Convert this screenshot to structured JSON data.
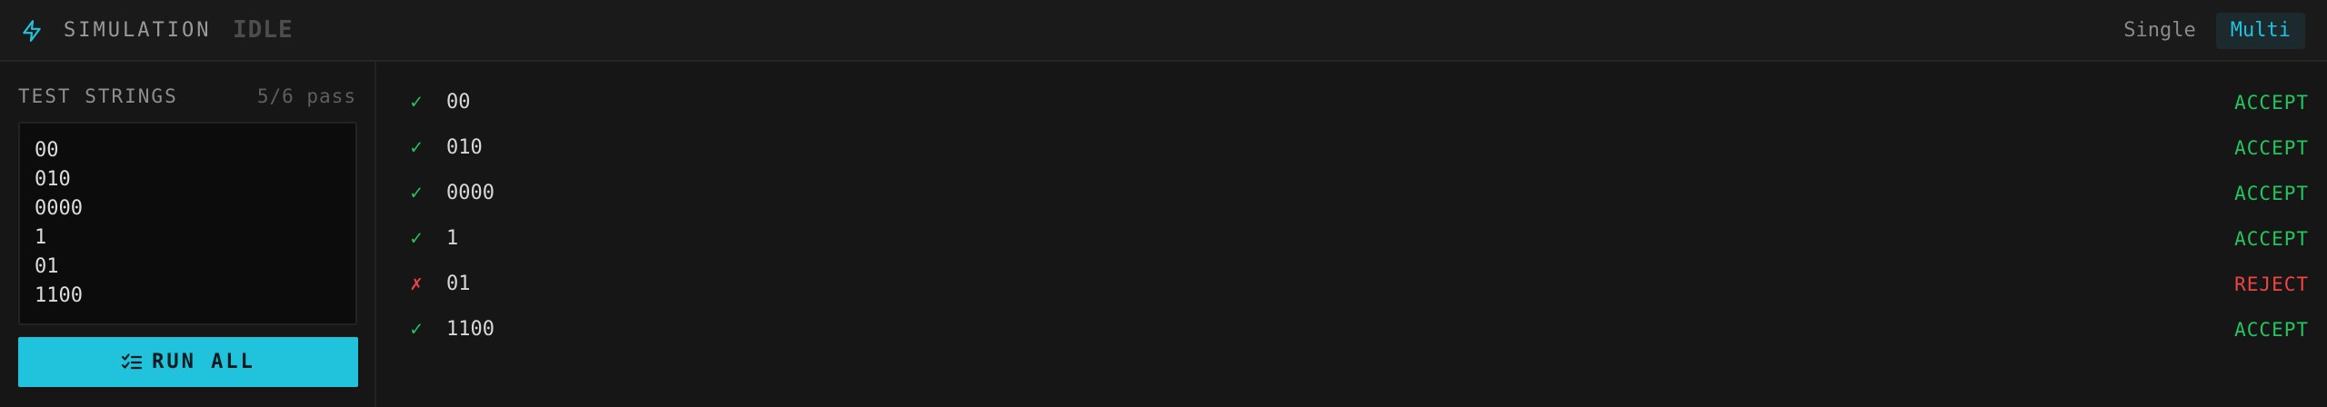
{
  "header": {
    "title": "SIMULATION",
    "status": "IDLE",
    "icon": "lightning-bolt-icon",
    "accent": "#22c1dc",
    "modes": {
      "single_label": "Single",
      "multi_label": "Multi",
      "selected": "Multi"
    }
  },
  "left": {
    "label": "TEST STRINGS",
    "pass_count": "5/6 pass",
    "strings": [
      "00",
      "010",
      "0000",
      "1",
      "01",
      "1100"
    ],
    "run_button": {
      "label": "RUN ALL",
      "icon": "checklist-icon"
    }
  },
  "results": [
    {
      "mark": "✓",
      "status": "pass",
      "string": "00",
      "verdict": "ACCEPT"
    },
    {
      "mark": "✓",
      "status": "pass",
      "string": "010",
      "verdict": "ACCEPT"
    },
    {
      "mark": "✓",
      "status": "pass",
      "string": "0000",
      "verdict": "ACCEPT"
    },
    {
      "mark": "✓",
      "status": "pass",
      "string": "1",
      "verdict": "ACCEPT"
    },
    {
      "mark": "✗",
      "status": "fail",
      "string": "01",
      "verdict": "REJECT"
    },
    {
      "mark": "✓",
      "status": "pass",
      "string": "1100",
      "verdict": "ACCEPT"
    }
  ],
  "colors": {
    "accept": "#22c55e",
    "reject": "#ef4444"
  }
}
